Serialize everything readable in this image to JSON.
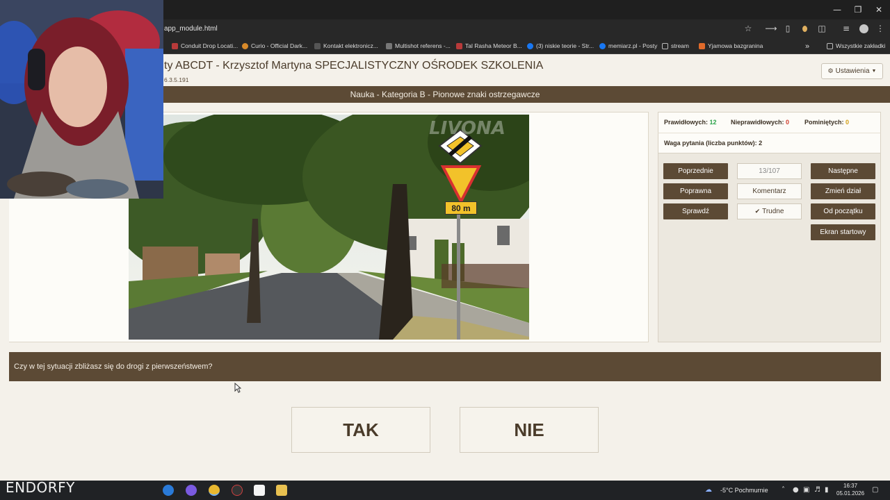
{
  "browser": {
    "url": "app_module.html",
    "bookmarks": [
      {
        "label": "Conduit Drop Locati...",
        "color": "#b83a3a"
      },
      {
        "label": "Curio - Official Dark...",
        "color": "#d88a2a"
      },
      {
        "label": "Kontakt elektronicz...",
        "color": "#555555"
      },
      {
        "label": "Multishot referens -...",
        "color": "#777777"
      },
      {
        "label": "Tal Rasha Meteor B...",
        "color": "#b83a3a"
      },
      {
        "label": "(3) niskie teorie - Str...",
        "color": "#1877f2"
      },
      {
        "label": "memiarz.pl - Posty",
        "color": "#1877f2"
      },
      {
        "label": "stream",
        "color": "#aaaaaa"
      },
      {
        "label": "Yjamowa bazgranina",
        "color": "#e06a2a"
      }
    ],
    "all_bookmarks": "Wszystkie zakładki"
  },
  "app": {
    "title": "ty ABCDT - Krzysztof Martyna SPECJALISTYCZNY OŚRODEK SZKOLENIA",
    "version": "6.3.5.191",
    "settings_label": "Ustawienia",
    "section": "Nauka - Kategoria B - Pionowe znaki ostrzegawcze",
    "watermark": "LIVONA",
    "sign_text": "80 m"
  },
  "stats": {
    "correct_label": "Prawidłowych:",
    "correct_value": "12",
    "wrong_label": "Nieprawidłowych:",
    "wrong_value": "0",
    "skipped_label": "Pominiętych:",
    "skipped_value": "0",
    "weight_label": "Waga pytania (liczba punktów): 2",
    "colors": {
      "correct": "#2aa34a",
      "wrong": "#d04030",
      "skipped": "#d4a017"
    }
  },
  "controls": {
    "previous": "Poprzednie",
    "counter": "13/107",
    "next": "Następne",
    "correct_answer": "Poprawna",
    "comment": "Komentarz",
    "change_section": "Zmień dział",
    "check": "Sprawdź",
    "difficult": "Trudne",
    "from_start": "Od początku",
    "start_screen": "Ekran startowy"
  },
  "question": {
    "text": "Czy w tej sytuacji zbliżasz się do drogi z pierwszeństwem?",
    "yes": "TAK",
    "no": "NIE"
  },
  "taskbar": {
    "brand": "ENDORFY",
    "weather": "-5°C  Pochmurnie",
    "time": "16:37",
    "date": "05.01.2026"
  }
}
